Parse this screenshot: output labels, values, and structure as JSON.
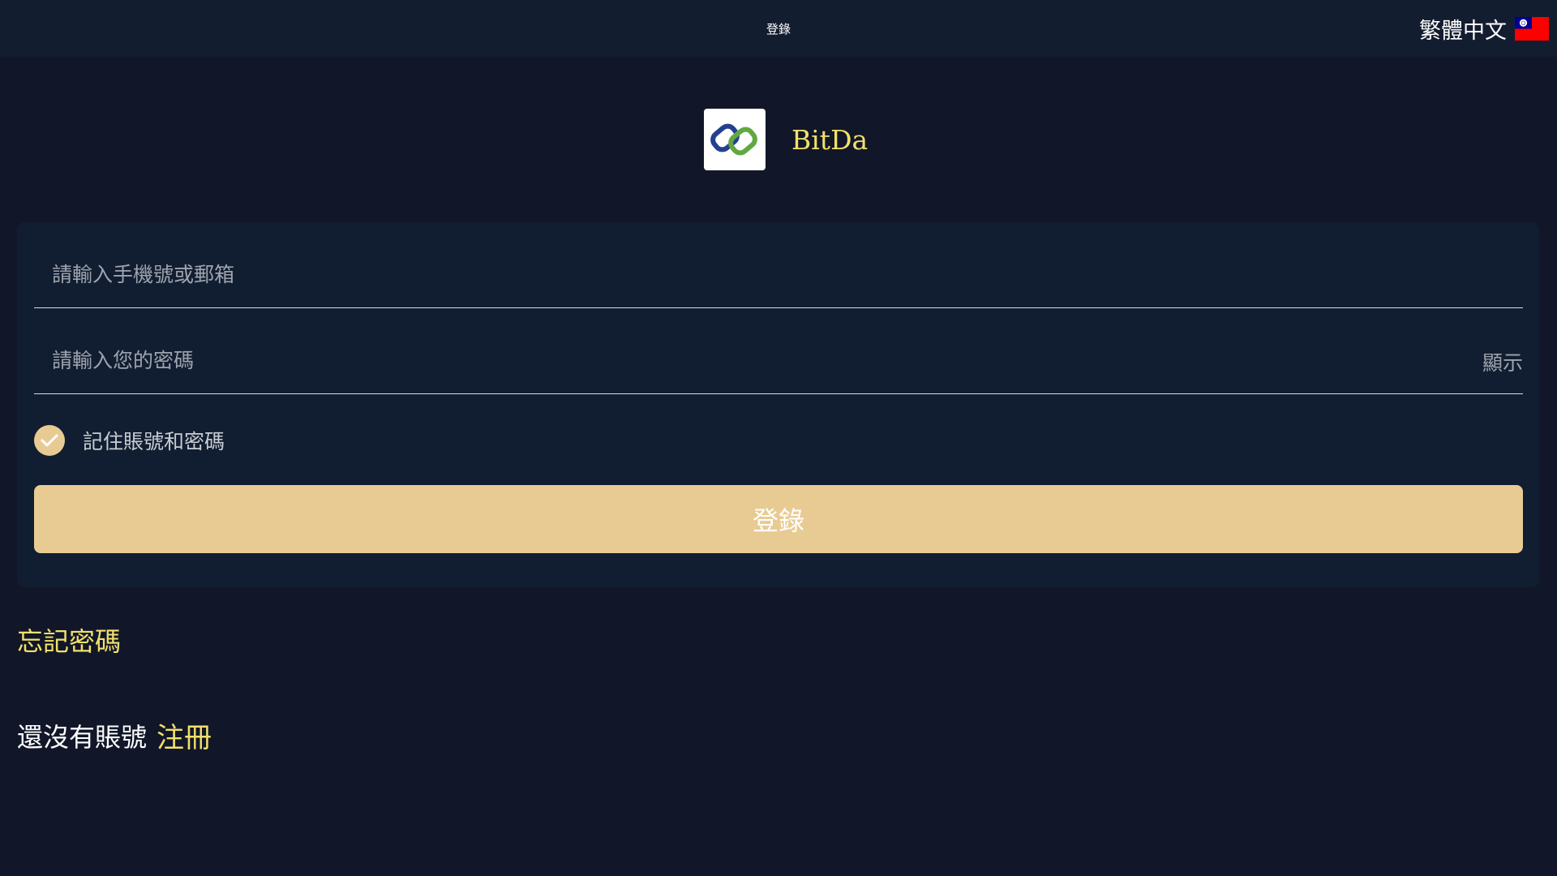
{
  "header": {
    "title": "登錄",
    "language_label": "繁體中文",
    "language_icon": "taiwan-flag-icon"
  },
  "brand": {
    "logo_icon": "bitda-logo-icon",
    "name": "BitDa"
  },
  "form": {
    "account_placeholder": "請輸入手機號或郵箱",
    "account_value": "",
    "password_placeholder": "請輸入您的密碼",
    "password_value": "",
    "show_label": "顯示",
    "remember_label": "記住賬號和密碼",
    "remember_checked": true,
    "submit_label": "登錄"
  },
  "links": {
    "forgot_password": "忘記密碼",
    "register_prompt": "還沒有賬號",
    "register_label": "注冊"
  },
  "colors": {
    "background": "#111729",
    "card": "#111e31",
    "accent_gold": "#e8cb93",
    "link_yellow": "#f3e06a"
  }
}
